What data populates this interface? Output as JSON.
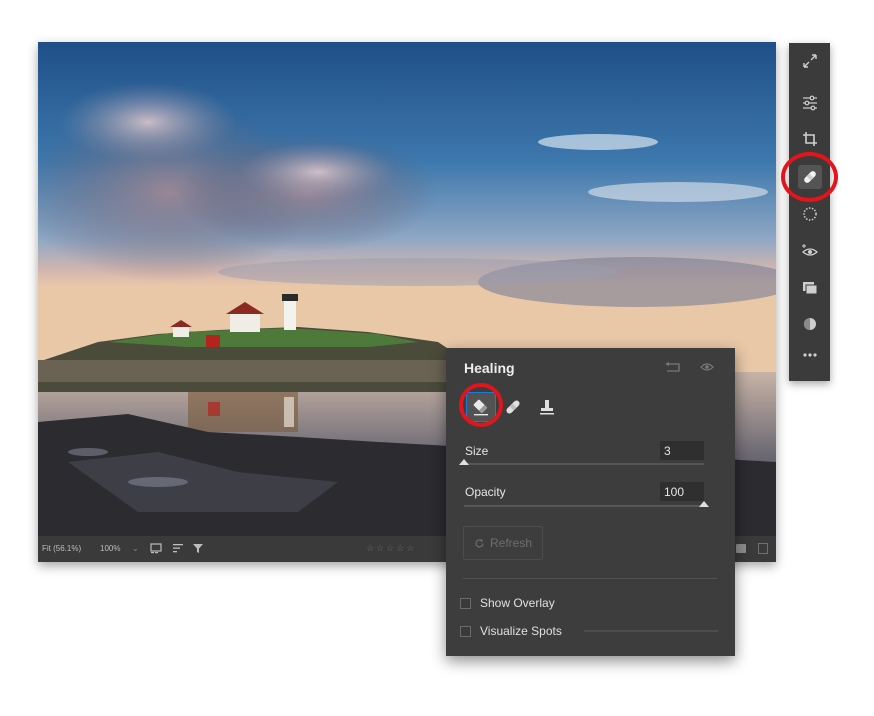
{
  "statusbar": {
    "fit": "Fit (56.1%)",
    "zoom": "100%",
    "zoom_chevron": "⌄",
    "stars": "☆☆☆☆☆",
    "icons": [
      "thumbnail-view-icon",
      "sort-icon",
      "filter-icon",
      "single-view-icon",
      "compare-view-icon"
    ]
  },
  "toolstrip": {
    "tools": [
      {
        "name": "fullscreen-icon"
      },
      {
        "name": "edit-sliders-icon"
      },
      {
        "name": "crop-icon"
      },
      {
        "name": "healing-icon",
        "active": true
      },
      {
        "name": "masking-icon"
      },
      {
        "name": "red-eye-icon"
      },
      {
        "name": "presets-icon"
      },
      {
        "name": "versions-icon"
      },
      {
        "name": "more-icon"
      }
    ]
  },
  "panel": {
    "title": "Healing",
    "size_label": "Size",
    "size_value": "3",
    "size": 0,
    "opacity_label": "Opacity",
    "opacity_value": "100",
    "opacity": 1,
    "refresh_label": "Refresh",
    "show_overlay_label": "Show Overlay",
    "visualize_spots_label": "Visualize Spots",
    "heal_tools": [
      "content-aware-remove-icon",
      "heal-icon",
      "clone-stamp-icon"
    ]
  },
  "colors": {
    "highlight_ring": "#e3141b",
    "panel_bg": "#3d3d3d",
    "selection_blue": "#1d7bd8"
  }
}
